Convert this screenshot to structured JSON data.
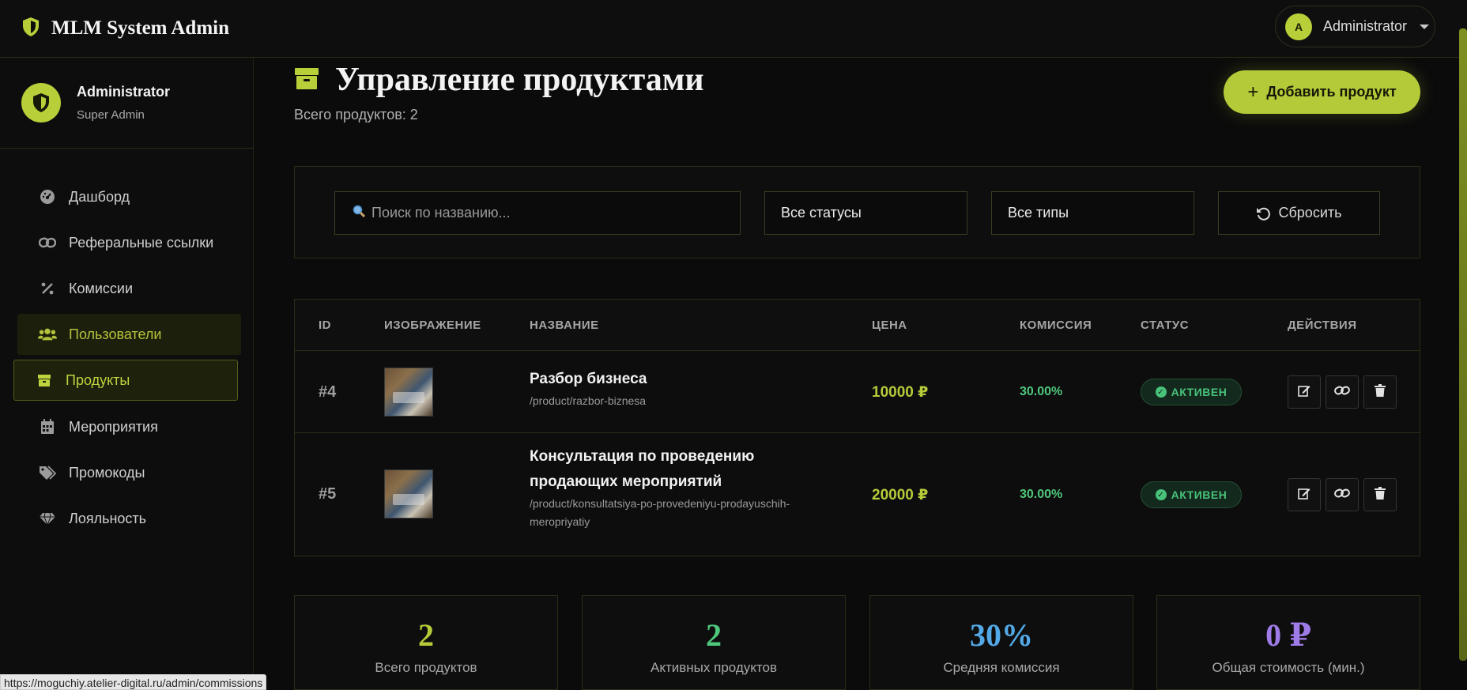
{
  "app": {
    "title": "MLM System Admin"
  },
  "header": {
    "user_initial": "A",
    "user_name": "Administrator"
  },
  "sidebar": {
    "profile": {
      "name": "Administrator",
      "role": "Super Admin"
    },
    "items": [
      {
        "label": "Дашборд",
        "icon": "dashboard-icon"
      },
      {
        "label": "Реферальные ссылки",
        "icon": "link-icon"
      },
      {
        "label": "Комиссии",
        "icon": "percent-icon"
      },
      {
        "label": "Пользователи",
        "icon": "users-icon"
      },
      {
        "label": "Продукты",
        "icon": "box-icon"
      },
      {
        "label": "Мероприятия",
        "icon": "calendar-icon"
      },
      {
        "label": "Промокоды",
        "icon": "tags-icon"
      },
      {
        "label": "Лояльность",
        "icon": "gem-icon"
      }
    ]
  },
  "page": {
    "title": "Управление продуктами",
    "total_text": "Всего продуктов: 2",
    "add_button": "Добавить продукт"
  },
  "filters": {
    "search_placeholder": "Поиск по названию...",
    "status_select": "Все статусы",
    "type_select": "Все типы",
    "reset_label": "Сбросить"
  },
  "table": {
    "headers": [
      "ID",
      "ИЗОБРАЖЕНИЕ",
      "НАЗВАНИЕ",
      "ЦЕНА",
      "КОМИССИЯ",
      "СТАТУС",
      "ДЕЙСТВИЯ"
    ],
    "rows": [
      {
        "id": "#4",
        "name": "Разбор бизнеса",
        "slug": "/product/razbor-biznesa",
        "price": "10000 ₽",
        "commission": "30.00%",
        "status": "АКТИВЕН"
      },
      {
        "id": "#5",
        "name_line1": "Консультация по проведению",
        "name_line2": "продающих мероприятий",
        "slug_line1": "/product/konsultatsiya-po-provedeniyu-prodayuschih-",
        "slug_line2": "meropriyatiy",
        "price": "20000 ₽",
        "commission": "30.00%",
        "status": "АКТИВЕН"
      }
    ]
  },
  "stats": [
    {
      "value": "2",
      "label": "Всего продуктов",
      "color": "#b6ca39"
    },
    {
      "value": "2",
      "label": "Активных продуктов",
      "color": "#4fc77c"
    },
    {
      "value": "30%",
      "label": "Средняя комиссия",
      "color": "#53a9e8"
    },
    {
      "value": "0 ₽",
      "label": "Общая стоимость (мин.)",
      "color": "#9f7be8"
    }
  ],
  "status_bar": {
    "url": "https://moguchiy.atelier-digital.ru/admin/commissions"
  },
  "colors": {
    "accent": "#b9cf3a",
    "background": "#0b0b0b",
    "active_green": "#48c27a"
  }
}
